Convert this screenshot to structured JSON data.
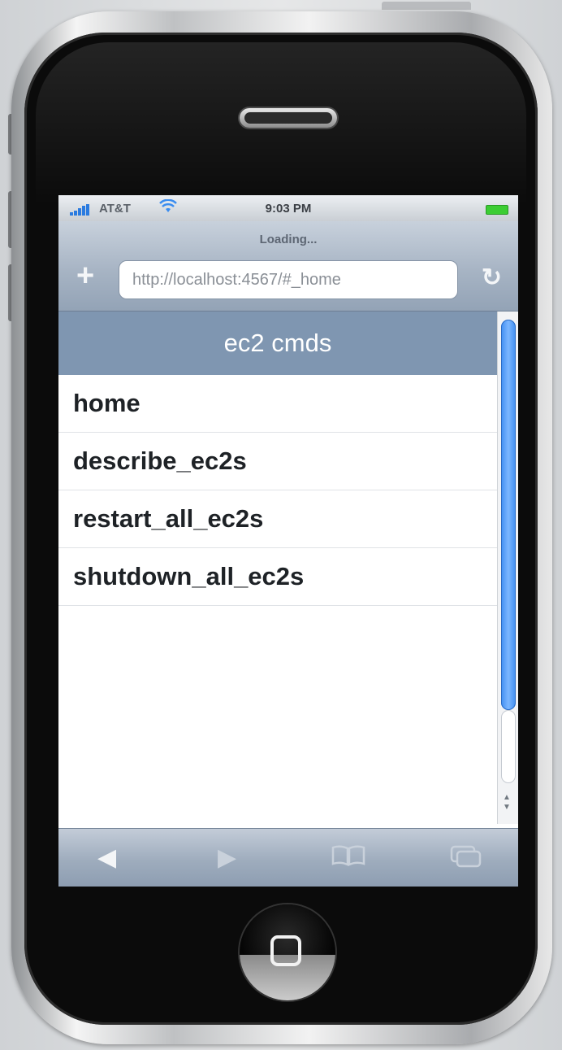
{
  "status_bar": {
    "carrier": "AT&T",
    "time": "9:03 PM",
    "battery_color": "#3ccd33"
  },
  "browser": {
    "loading_text": "Loading...",
    "url": "http://localhost:4567/#_home",
    "add_icon": "+",
    "reload_icon": "↻"
  },
  "page": {
    "header": "ec2 cmds",
    "menu_items": [
      "home",
      "describe_ec2s",
      "restart_all_ec2s",
      "shutdown_all_ec2s"
    ]
  },
  "toolbar": {
    "back_icon": "◀",
    "forward_icon": "▶",
    "bookmarks_icon": "bookmarks-icon",
    "pages_icon": "pages-icon"
  },
  "colors": {
    "header_bg": "#7f96b1",
    "scroll_thumb": "#3f8ef2"
  }
}
